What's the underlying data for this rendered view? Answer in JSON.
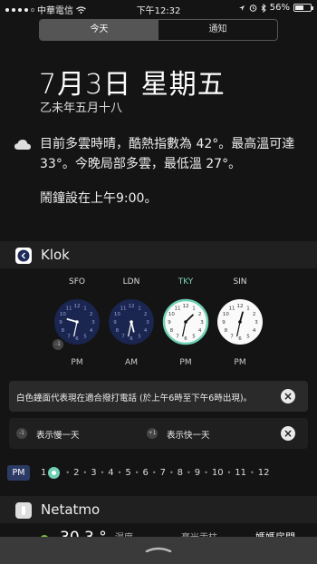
{
  "status_bar": {
    "carrier": "中華電信",
    "time": "下午12:32",
    "battery": "56%",
    "battery_level": 0.56,
    "signal_dots": 4
  },
  "segment": {
    "tabs": [
      "今天",
      "通知"
    ],
    "active": 0
  },
  "today": {
    "date": "7月3日 星期五",
    "lunar": "乙未年五月十八",
    "weather": "目前多雲時晴，酷熱指數為 42°。最高溫可達 33°。今晚局部多雲，最低溫 27°。",
    "weather_icon": "cloud-icon",
    "alarm": "鬧鐘設在上午9:00。"
  },
  "klok": {
    "title": "Klok",
    "clocks": [
      {
        "city": "SFO",
        "ampm": "PM",
        "style": "dark",
        "badge": "-1",
        "hour": 9,
        "minute": 32
      },
      {
        "city": "LDN",
        "ampm": "AM",
        "style": "dark",
        "hour": 5,
        "minute": 32
      },
      {
        "city": "TKY",
        "ampm": "PM",
        "style": "light",
        "highlight": true,
        "hour": 1,
        "minute": 32
      },
      {
        "city": "SIN",
        "ampm": "PM",
        "style": "light",
        "hour": 12,
        "minute": 32
      }
    ],
    "banner": "白色鐘面代表現在適合撥打電話 (於上午6時至下午6時出現)。",
    "show_prev_badge": "-1",
    "show_prev": "表示慢一天",
    "show_next_badge": "+1",
    "show_next": "表示快一天",
    "pm_label": "PM",
    "hours": [
      "1",
      "2",
      "3",
      "4",
      "5",
      "6",
      "7",
      "8",
      "9",
      "10",
      "11",
      "12"
    ],
    "selected_hour": "1"
  },
  "netatmo": {
    "title": "Netatmo",
    "temp": "30.3 °",
    "humidity_label": "濕度",
    "rain_label": "毫米汞柱",
    "room_label": "媽媽房間"
  }
}
